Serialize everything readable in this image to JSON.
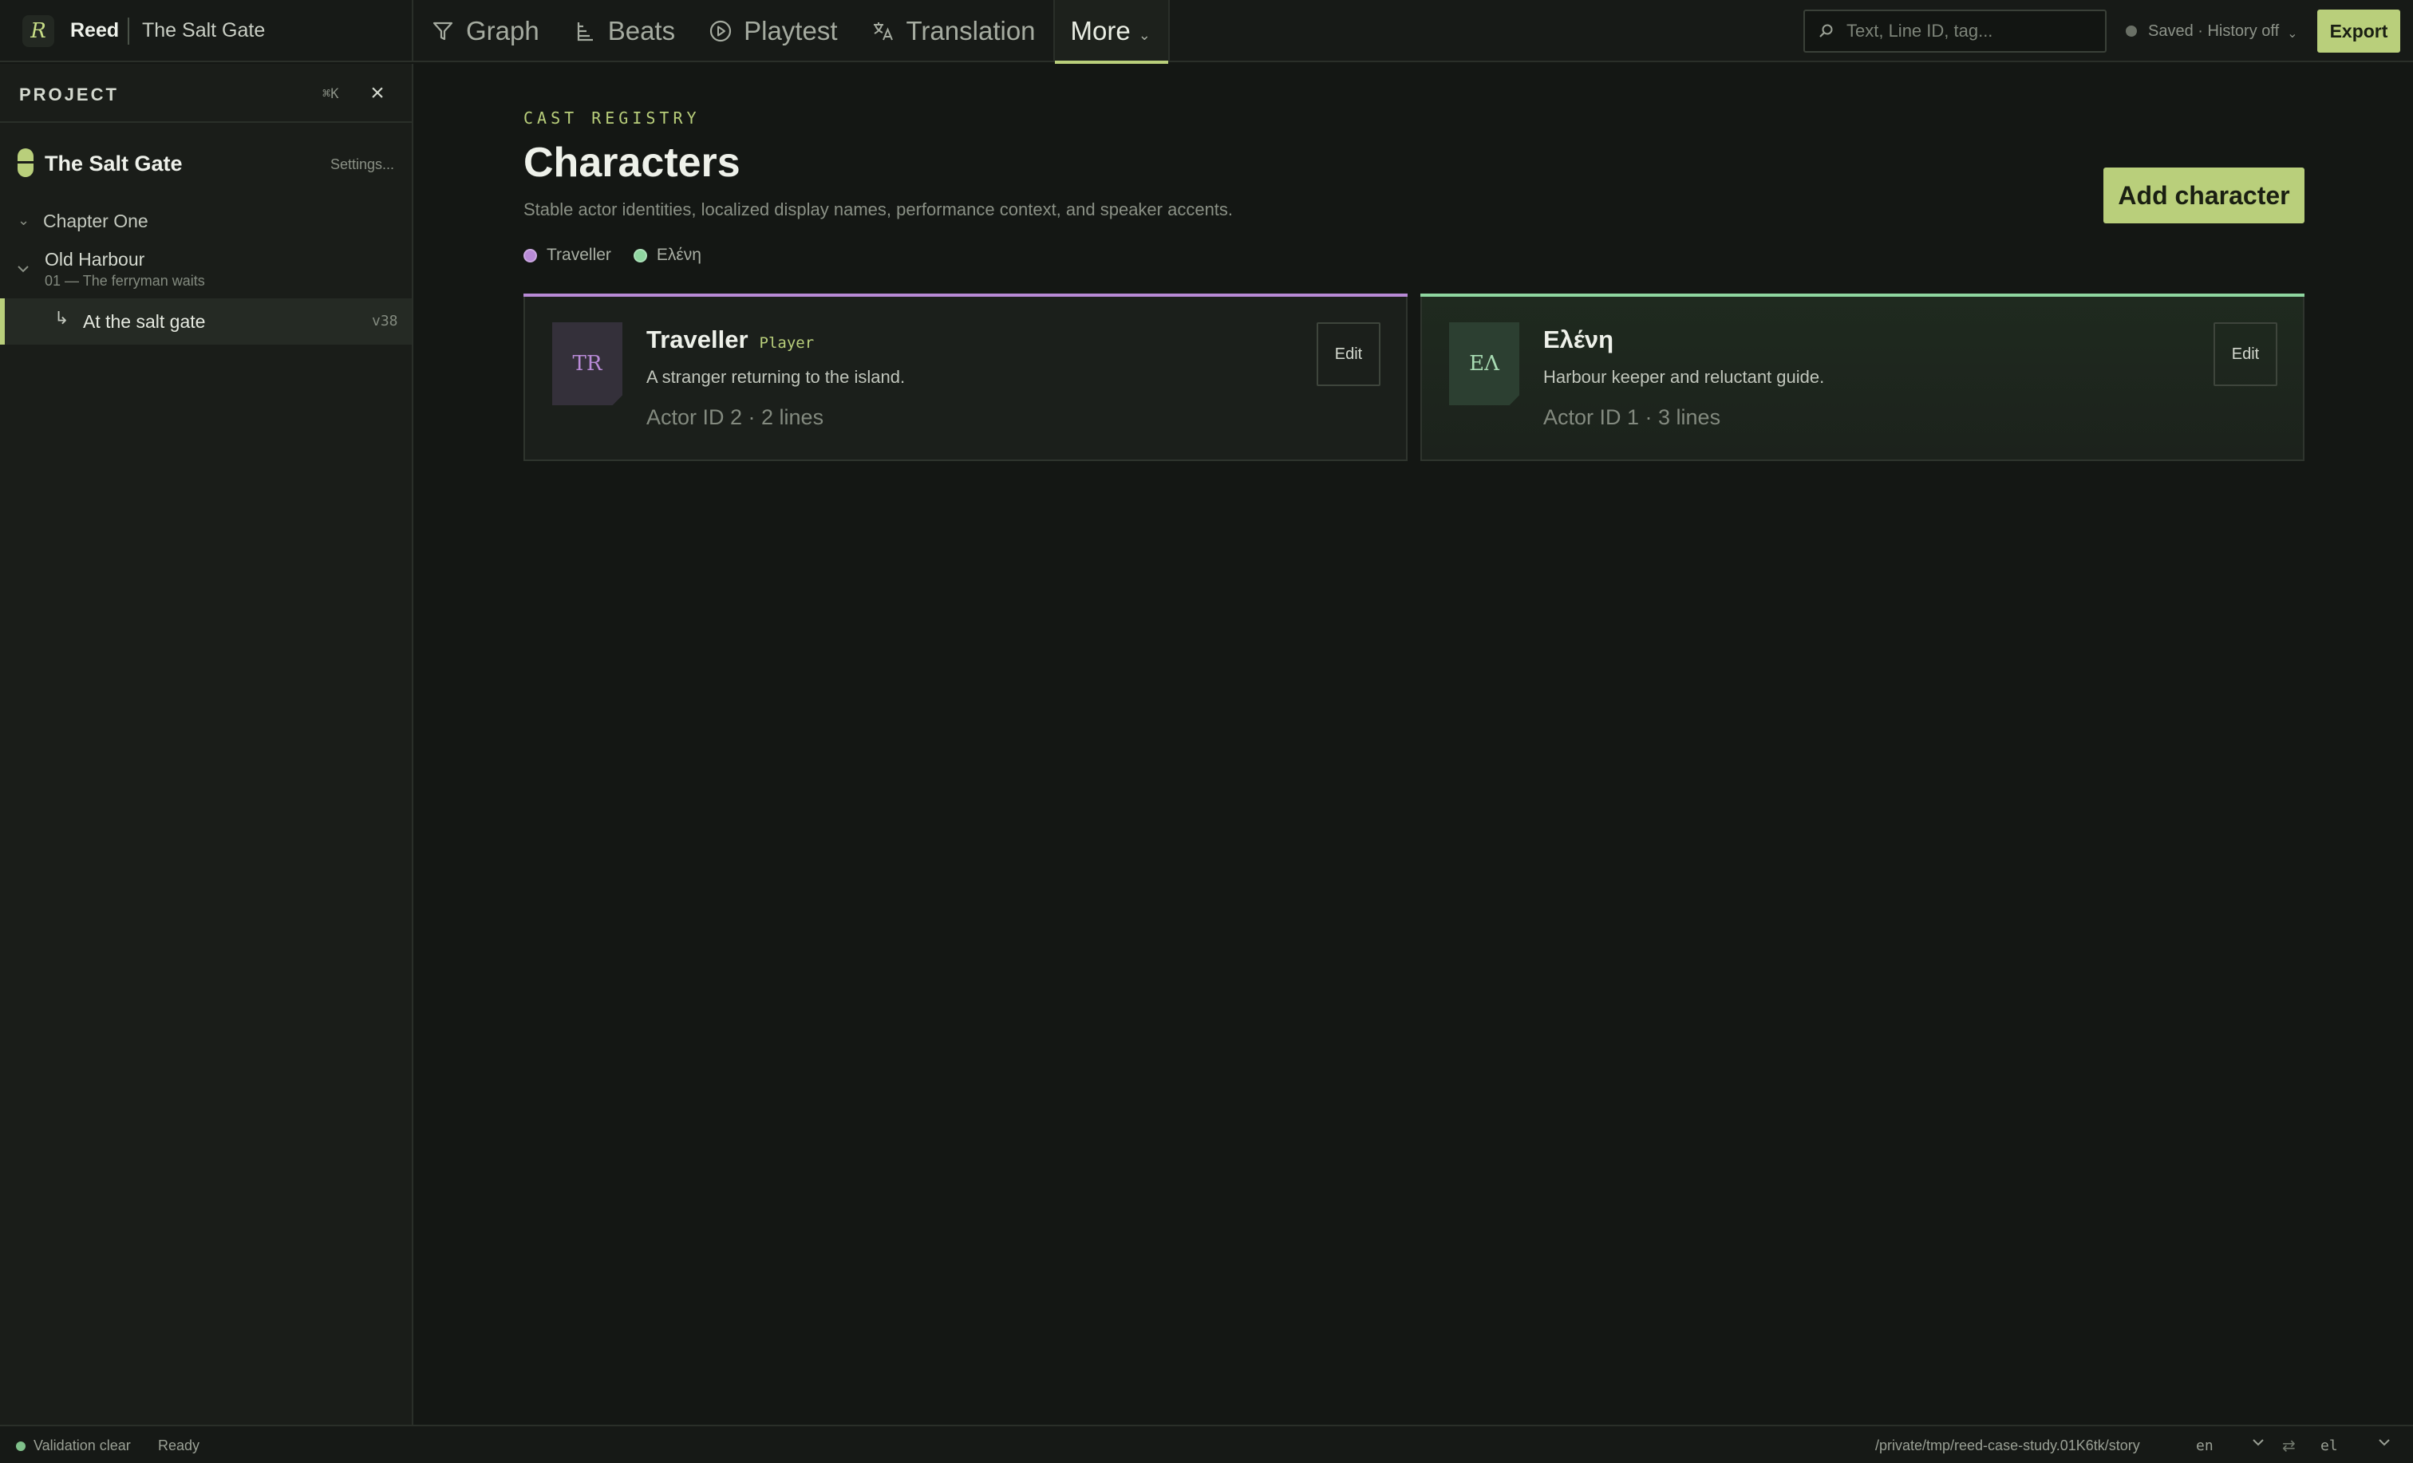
{
  "app": {
    "name": "Reed",
    "project": "The Salt Gate",
    "logo_glyph": "R"
  },
  "nav": {
    "tabs": [
      {
        "label": "Graph",
        "icon": "graph-icon"
      },
      {
        "label": "Beats",
        "icon": "beats-icon"
      },
      {
        "label": "Playtest",
        "icon": "play-icon"
      },
      {
        "label": "Translation",
        "icon": "translate-icon"
      }
    ],
    "more_label": "More",
    "caret": "⌄"
  },
  "toolbar": {
    "search_placeholder": "Text, Line ID, tag...",
    "save_status": "Saved · History off",
    "export_label": "Export"
  },
  "sidebar": {
    "title": "PROJECT",
    "shortcut": "⌘K",
    "close": "×",
    "project_name": "The Salt Gate",
    "settings_label": "Settings...",
    "chapter": "Chapter One",
    "scene_title": "Old Harbour",
    "scene_subtitle": "01 — The ferryman waits",
    "node_arrow": "↳",
    "node_label": "At the salt gate",
    "node_version": "v38"
  },
  "main": {
    "eyebrow": "CAST REGISTRY",
    "title": "Characters",
    "description": "Stable actor identities, localized display names, performance context, and speaker accents.",
    "add_label": "Add character",
    "legend": [
      {
        "label": "Traveller",
        "color": "#b88ad6"
      },
      {
        "label": "Ελένη",
        "color": "#8fd6a0"
      }
    ]
  },
  "characters": [
    {
      "initials": "TR",
      "name": "Traveller",
      "role": "Player",
      "description": "A stranger returning to the island.",
      "meta": "Actor ID 2 · 2 lines",
      "edit_label": "Edit",
      "accent": "#b88ad6",
      "avatar_bg": "#34303a",
      "avatar_fg": "#b88ad6"
    },
    {
      "initials": "ΕΛ",
      "name": "Ελένη",
      "role": "",
      "description": "Harbour keeper and reluctant guide.",
      "meta": "Actor ID 1 · 3 lines",
      "edit_label": "Edit",
      "accent": "#8fd6a0",
      "avatar_bg": "#2c3f31",
      "avatar_fg": "#a8dcb3"
    }
  ],
  "statusbar": {
    "validation": "Validation clear",
    "ready": "Ready",
    "path": "/private/tmp/reed-case-study.01K6tk/story",
    "source_lang": "en",
    "target_lang": "el",
    "swap": "⇄",
    "caret": "⌄"
  },
  "colors": {
    "accent": "#b9cf7b",
    "background": "#141714",
    "validation_ok": "#7fc08a"
  }
}
